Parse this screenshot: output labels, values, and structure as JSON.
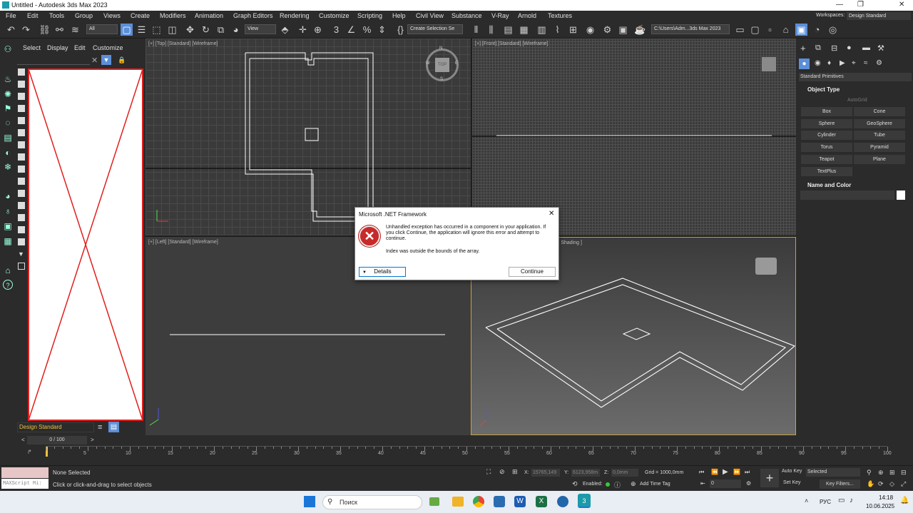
{
  "app": {
    "title": "Untitled - Autodesk 3ds Max 2023"
  },
  "menu": [
    "File",
    "Edit",
    "Tools",
    "Group",
    "Views",
    "Create",
    "Modifiers",
    "Animation",
    "Graph Editors",
    "Rendering",
    "Customize",
    "Scripting",
    "Help",
    "Civil View",
    "Substance",
    "V-Ray",
    "Arnold",
    "Textures"
  ],
  "workspace": {
    "label": "Workspaces:",
    "value": "Design Standard"
  },
  "toolbar": {
    "filter": "All",
    "view": "View",
    "selection_set": "Create Selection Se",
    "path": "C:\\Users\\Adm...3ds Max 2023"
  },
  "explorer": {
    "tabs": [
      "Select",
      "Display",
      "Edit",
      "Customize"
    ],
    "workspace": "Design Standard"
  },
  "viewports": {
    "top": "[+] [Top] [Standard] [Wireframe]",
    "front": "[+] [Front] [Standard] [Wireframe]",
    "left": "[+] [Left] [Standard] [Wireframe]",
    "persp": "ult Shading ]"
  },
  "compass": {
    "n": "N",
    "s": "S",
    "w": "W",
    "e": "E",
    "cube": "TOP"
  },
  "command_panel": {
    "category": "Standard Primitives",
    "object_type": "Object Type",
    "autogrid": "AutoGrid",
    "primitives": [
      "Box",
      "Cone",
      "Sphere",
      "GeoSphere",
      "Cylinder",
      "Tube",
      "Torus",
      "Pyramid",
      "Teapot",
      "Plane",
      "TextPlus"
    ],
    "name_color": "Name and Color"
  },
  "timeline": {
    "frame": "0 / 100",
    "ticks": [
      "0",
      "5",
      "10",
      "15",
      "20",
      "25",
      "30",
      "35",
      "40",
      "45",
      "50",
      "55",
      "60",
      "65",
      "70",
      "75",
      "80",
      "85",
      "90",
      "95",
      "100"
    ]
  },
  "status": {
    "maxscript": "MAXScript Mi:",
    "selection": "None Selected",
    "hint": "Click or click-and-drag to select objects",
    "x_label": "X:",
    "x": "15765,149",
    "y_label": "Y:",
    "y": "6123,958m",
    "z_label": "Z:",
    "z": "0,0mm",
    "grid": "Grid = 1000,0mm",
    "enabled": "Enabled:",
    "add_time_tag": "Add Time Tag",
    "auto_key": "Auto Key",
    "set_key": "Set Key",
    "selected": "Selected",
    "key_filters": "Key Filters...",
    "frame": "0"
  },
  "dialog": {
    "title": "Microsoft .NET Framework",
    "message": "Unhandled exception has occurred in a component in your application. If you click Continue, the application will ignore this error and attempt to continue.",
    "detail": "Index was outside the bounds of the array.",
    "details_btn": "Details",
    "continue_btn": "Continue"
  },
  "taskbar": {
    "search": "Поиск",
    "lang": "РУС",
    "time": "14:18",
    "date": "10.06.2025"
  }
}
